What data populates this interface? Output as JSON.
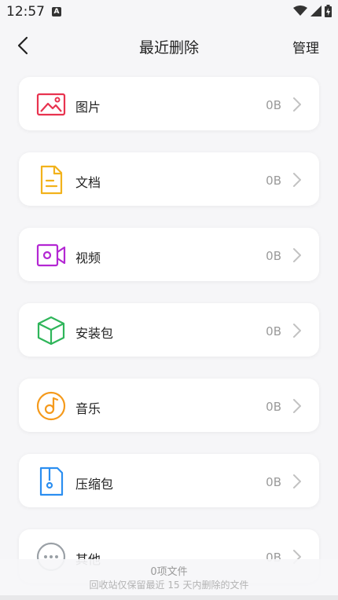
{
  "status_bar": {
    "time": "12:57",
    "notification_icon": "A"
  },
  "header": {
    "title": "最近删除",
    "action": "管理"
  },
  "categories": [
    {
      "label": "图片",
      "size": "0B",
      "icon": "image-icon",
      "color": "#e8334f"
    },
    {
      "label": "文档",
      "size": "0B",
      "icon": "document-icon",
      "color": "#f2b21b"
    },
    {
      "label": "视频",
      "size": "0B",
      "icon": "video-icon",
      "color": "#b327d3"
    },
    {
      "label": "安装包",
      "size": "0B",
      "icon": "package-icon",
      "color": "#2fb55a"
    },
    {
      "label": "音乐",
      "size": "0B",
      "icon": "music-icon",
      "color": "#f59a1c"
    },
    {
      "label": "压缩包",
      "size": "0B",
      "icon": "archive-icon",
      "color": "#2b8ef0"
    },
    {
      "label": "其他",
      "size": "0B",
      "icon": "more-icon",
      "color": "#9aa0a6"
    }
  ],
  "footer": {
    "count": "0项文件",
    "note": "回收站仅保留最近 15 天内删除的文件"
  }
}
